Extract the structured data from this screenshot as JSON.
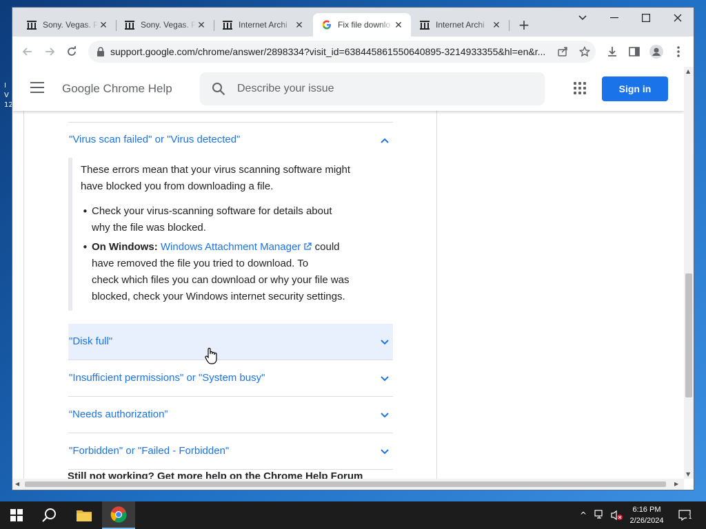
{
  "browser": {
    "tabs": [
      {
        "title": "Sony. Vegas. P",
        "icon": "archive-icon"
      },
      {
        "title": "Sony. Vegas. P",
        "icon": "archive-icon"
      },
      {
        "title": "Internet Archi",
        "icon": "archive-icon"
      },
      {
        "title": "Fix file downlo",
        "icon": "google-icon",
        "active": true
      },
      {
        "title": "Internet Archi",
        "icon": "archive-icon"
      }
    ],
    "url": "support.google.com/chrome/answer/2898334?visit_id=638445861550640895-3214933355&hl=en&r..."
  },
  "help_header": {
    "title": "Google Chrome Help",
    "search_placeholder": "Describe your issue",
    "signin_label": "Sign in"
  },
  "article": {
    "virus_heading": "\"Virus scan failed\" or \"Virus detected\"",
    "virus_intro": [
      "These errors mean that your virus scanning software might",
      "have blocked you from downloading a file."
    ],
    "bullet1": [
      "Check your virus-scanning software for details about",
      "why the file was blocked."
    ],
    "bullet2_label": "On Windows:",
    "bullet2_link": "Windows Attachment Manager",
    "bullet2_after": "could",
    "bullet2_lines": [
      "have removed the file you tried to download. To",
      "check which files you can download or why your file was",
      "blocked, check your Windows internet security settings."
    ],
    "accordions": [
      "\"Disk full\"",
      "\"Insufficient permissions\" or \"System busy\"",
      "“Needs authorization”",
      "\"Forbidden\" or \"Failed - Forbidden\""
    ],
    "bottom_fragment": "Still not working? Get more help on the Chrome Help Forum"
  },
  "taskbar": {
    "time": "6:16 PM",
    "date": "2/26/2024",
    "notification_count": "1"
  },
  "desktop_fragment": [
    "I",
    "V",
    "12"
  ]
}
